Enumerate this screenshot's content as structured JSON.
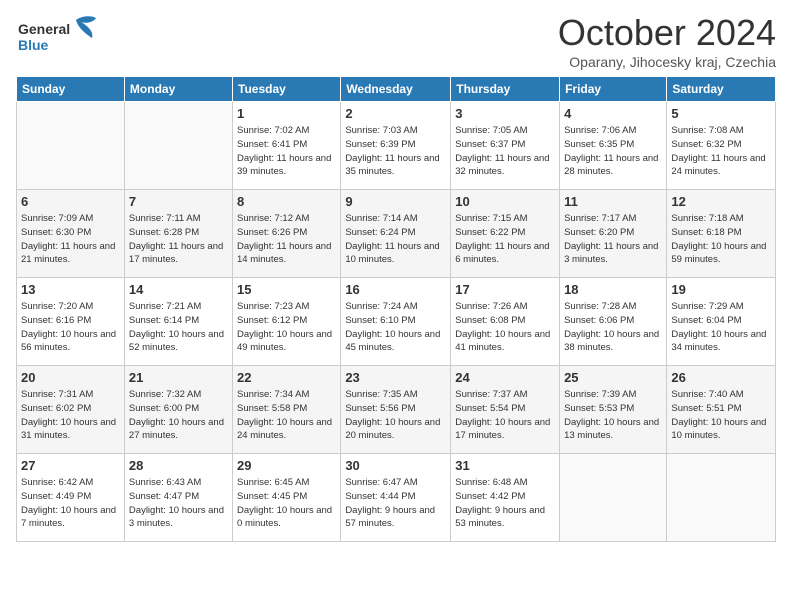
{
  "logo": {
    "line1": "General",
    "line2": "Blue"
  },
  "title": "October 2024",
  "subtitle": "Oparany, Jihocesky kraj, Czechia",
  "days_header": [
    "Sunday",
    "Monday",
    "Tuesday",
    "Wednesday",
    "Thursday",
    "Friday",
    "Saturday"
  ],
  "weeks": [
    [
      {
        "num": "",
        "info": ""
      },
      {
        "num": "",
        "info": ""
      },
      {
        "num": "1",
        "info": "Sunrise: 7:02 AM\nSunset: 6:41 PM\nDaylight: 11 hours\nand 39 minutes."
      },
      {
        "num": "2",
        "info": "Sunrise: 7:03 AM\nSunset: 6:39 PM\nDaylight: 11 hours\nand 35 minutes."
      },
      {
        "num": "3",
        "info": "Sunrise: 7:05 AM\nSunset: 6:37 PM\nDaylight: 11 hours\nand 32 minutes."
      },
      {
        "num": "4",
        "info": "Sunrise: 7:06 AM\nSunset: 6:35 PM\nDaylight: 11 hours\nand 28 minutes."
      },
      {
        "num": "5",
        "info": "Sunrise: 7:08 AM\nSunset: 6:32 PM\nDaylight: 11 hours\nand 24 minutes."
      }
    ],
    [
      {
        "num": "6",
        "info": "Sunrise: 7:09 AM\nSunset: 6:30 PM\nDaylight: 11 hours\nand 21 minutes."
      },
      {
        "num": "7",
        "info": "Sunrise: 7:11 AM\nSunset: 6:28 PM\nDaylight: 11 hours\nand 17 minutes."
      },
      {
        "num": "8",
        "info": "Sunrise: 7:12 AM\nSunset: 6:26 PM\nDaylight: 11 hours\nand 14 minutes."
      },
      {
        "num": "9",
        "info": "Sunrise: 7:14 AM\nSunset: 6:24 PM\nDaylight: 11 hours\nand 10 minutes."
      },
      {
        "num": "10",
        "info": "Sunrise: 7:15 AM\nSunset: 6:22 PM\nDaylight: 11 hours\nand 6 minutes."
      },
      {
        "num": "11",
        "info": "Sunrise: 7:17 AM\nSunset: 6:20 PM\nDaylight: 11 hours\nand 3 minutes."
      },
      {
        "num": "12",
        "info": "Sunrise: 7:18 AM\nSunset: 6:18 PM\nDaylight: 10 hours\nand 59 minutes."
      }
    ],
    [
      {
        "num": "13",
        "info": "Sunrise: 7:20 AM\nSunset: 6:16 PM\nDaylight: 10 hours\nand 56 minutes."
      },
      {
        "num": "14",
        "info": "Sunrise: 7:21 AM\nSunset: 6:14 PM\nDaylight: 10 hours\nand 52 minutes."
      },
      {
        "num": "15",
        "info": "Sunrise: 7:23 AM\nSunset: 6:12 PM\nDaylight: 10 hours\nand 49 minutes."
      },
      {
        "num": "16",
        "info": "Sunrise: 7:24 AM\nSunset: 6:10 PM\nDaylight: 10 hours\nand 45 minutes."
      },
      {
        "num": "17",
        "info": "Sunrise: 7:26 AM\nSunset: 6:08 PM\nDaylight: 10 hours\nand 41 minutes."
      },
      {
        "num": "18",
        "info": "Sunrise: 7:28 AM\nSunset: 6:06 PM\nDaylight: 10 hours\nand 38 minutes."
      },
      {
        "num": "19",
        "info": "Sunrise: 7:29 AM\nSunset: 6:04 PM\nDaylight: 10 hours\nand 34 minutes."
      }
    ],
    [
      {
        "num": "20",
        "info": "Sunrise: 7:31 AM\nSunset: 6:02 PM\nDaylight: 10 hours\nand 31 minutes."
      },
      {
        "num": "21",
        "info": "Sunrise: 7:32 AM\nSunset: 6:00 PM\nDaylight: 10 hours\nand 27 minutes."
      },
      {
        "num": "22",
        "info": "Sunrise: 7:34 AM\nSunset: 5:58 PM\nDaylight: 10 hours\nand 24 minutes."
      },
      {
        "num": "23",
        "info": "Sunrise: 7:35 AM\nSunset: 5:56 PM\nDaylight: 10 hours\nand 20 minutes."
      },
      {
        "num": "24",
        "info": "Sunrise: 7:37 AM\nSunset: 5:54 PM\nDaylight: 10 hours\nand 17 minutes."
      },
      {
        "num": "25",
        "info": "Sunrise: 7:39 AM\nSunset: 5:53 PM\nDaylight: 10 hours\nand 13 minutes."
      },
      {
        "num": "26",
        "info": "Sunrise: 7:40 AM\nSunset: 5:51 PM\nDaylight: 10 hours\nand 10 minutes."
      }
    ],
    [
      {
        "num": "27",
        "info": "Sunrise: 6:42 AM\nSunset: 4:49 PM\nDaylight: 10 hours\nand 7 minutes."
      },
      {
        "num": "28",
        "info": "Sunrise: 6:43 AM\nSunset: 4:47 PM\nDaylight: 10 hours\nand 3 minutes."
      },
      {
        "num": "29",
        "info": "Sunrise: 6:45 AM\nSunset: 4:45 PM\nDaylight: 10 hours\nand 0 minutes."
      },
      {
        "num": "30",
        "info": "Sunrise: 6:47 AM\nSunset: 4:44 PM\nDaylight: 9 hours\nand 57 minutes."
      },
      {
        "num": "31",
        "info": "Sunrise: 6:48 AM\nSunset: 4:42 PM\nDaylight: 9 hours\nand 53 minutes."
      },
      {
        "num": "",
        "info": ""
      },
      {
        "num": "",
        "info": ""
      }
    ]
  ]
}
